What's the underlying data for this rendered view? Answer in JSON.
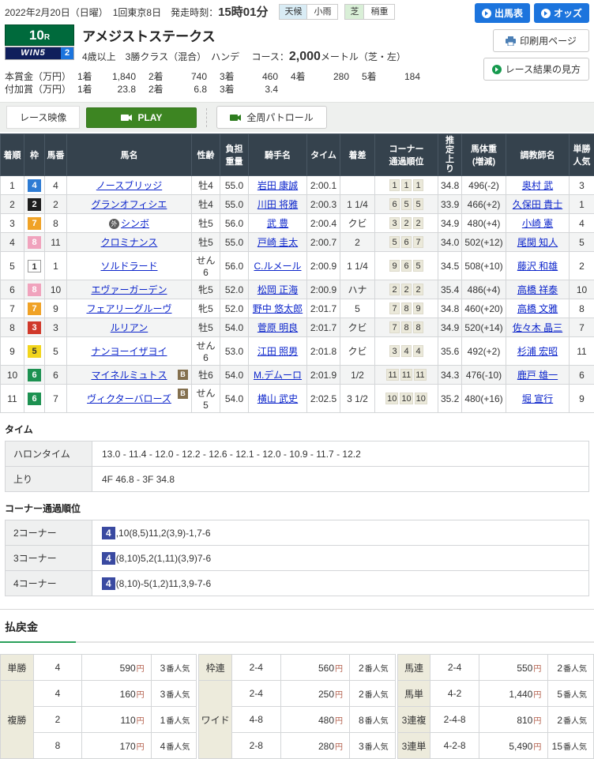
{
  "colors": {
    "accent_blue": "#1c74dd",
    "accent_green": "#3d8522",
    "race_badge_green": "#006a3c",
    "header_slate": "#35424d",
    "payout_underline_green": "#2aa05a",
    "corner_leader_indigo": "#3a4aa1",
    "waku": {
      "1": "#ffffff",
      "2": "#1d1d1d",
      "3": "#d0392b",
      "4": "#2d7bd3",
      "5": "#f2d51c",
      "6": "#1d9151",
      "7": "#f0a226",
      "8": "#f0a3bd"
    }
  },
  "header": {
    "date_line": "2022年2月20日（日曜）　1回東京8日　",
    "start_label": "発走時刻：",
    "start_time": "15時01分",
    "weather_label": "天候",
    "weather_value": "小雨",
    "turf_label": "芝",
    "turf_value": "稍重",
    "btn_entries": "出馬表",
    "btn_odds": "オッズ",
    "btn_print": "印刷用ページ",
    "btn_guide": "レース結果の見方"
  },
  "race": {
    "number": "10",
    "number_suffix": "R",
    "win5_text": "WIN5",
    "win5_num": "2",
    "name": "アメジストステークス",
    "conditions": "4歳以上　3勝クラス（混合）　ハンデ",
    "course_label": "コース：",
    "course_distance": "2,000",
    "course_unit": "メートル（芝・左）"
  },
  "prize": {
    "main_label": "本賞金（万円）",
    "main": [
      [
        "1着",
        "1,840"
      ],
      [
        "2着",
        "740"
      ],
      [
        "3着",
        "460"
      ],
      [
        "4着",
        "280"
      ],
      [
        "5着",
        "184"
      ]
    ],
    "added_label": "付加賞（万円）",
    "added": [
      [
        "1着",
        "23.8"
      ],
      [
        "2着",
        "6.8"
      ],
      [
        "3着",
        "3.4"
      ]
    ]
  },
  "video": {
    "label": "レース映像",
    "play": "PLAY",
    "patrol": "全周パトロール"
  },
  "results": {
    "headers": [
      "着順",
      "枠",
      "馬番",
      "馬名",
      "性齢",
      "負担\n重量",
      "騎手名",
      "タイム",
      "着差",
      "コーナー\n通過順位",
      "推定上り",
      "馬体重\n(増減)",
      "調教師名",
      "単勝\n人気"
    ],
    "rows": [
      {
        "pos": "1",
        "waku": "4",
        "num": "4",
        "mark": "",
        "horse": "ノースブリッジ",
        "blinker": false,
        "sex_age": "牡4",
        "weight": "55.0",
        "jockey": "岩田 康誠",
        "time": "2:00.1",
        "margin": "",
        "corners": [
          "1",
          "1",
          "1"
        ],
        "last3f": "34.8",
        "body": "496(-2)",
        "trainer": "奥村 武",
        "pop": "3"
      },
      {
        "pos": "2",
        "waku": "2",
        "num": "2",
        "mark": "",
        "horse": "グランオフィシエ",
        "blinker": false,
        "sex_age": "牡4",
        "weight": "55.0",
        "jockey": "川田 将雅",
        "time": "2:00.3",
        "margin": "1 1/4",
        "corners": [
          "6",
          "5",
          "5"
        ],
        "last3f": "33.9",
        "body": "466(+2)",
        "trainer": "久保田 貴士",
        "pop": "1"
      },
      {
        "pos": "3",
        "waku": "7",
        "num": "8",
        "mark": "外",
        "horse": "シンボ",
        "blinker": false,
        "sex_age": "牡5",
        "weight": "56.0",
        "jockey": "武 豊",
        "time": "2:00.4",
        "margin": "クビ",
        "corners": [
          "3",
          "2",
          "2"
        ],
        "last3f": "34.9",
        "body": "480(+4)",
        "trainer": "小崎 憲",
        "pop": "4"
      },
      {
        "pos": "4",
        "waku": "8",
        "num": "11",
        "mark": "",
        "horse": "クロミナンス",
        "blinker": false,
        "sex_age": "牡5",
        "weight": "55.0",
        "jockey": "戸崎 圭太",
        "time": "2:00.7",
        "margin": "2",
        "corners": [
          "5",
          "6",
          "7"
        ],
        "last3f": "34.0",
        "body": "502(+12)",
        "trainer": "尾関 知人",
        "pop": "5"
      },
      {
        "pos": "5",
        "waku": "1",
        "num": "1",
        "mark": "",
        "horse": "ソルドラード",
        "blinker": false,
        "sex_age": "せん6",
        "weight": "56.0",
        "jockey": "C.ルメール",
        "time": "2:00.9",
        "margin": "1 1/4",
        "corners": [
          "9",
          "6",
          "5"
        ],
        "last3f": "34.5",
        "body": "508(+10)",
        "trainer": "藤沢 和雄",
        "pop": "2"
      },
      {
        "pos": "6",
        "waku": "8",
        "num": "10",
        "mark": "",
        "horse": "エヴァーガーデン",
        "blinker": false,
        "sex_age": "牝5",
        "weight": "52.0",
        "jockey": "松岡 正海",
        "time": "2:00.9",
        "margin": "ハナ",
        "corners": [
          "2",
          "2",
          "2"
        ],
        "last3f": "35.4",
        "body": "486(+4)",
        "trainer": "高橋 祥泰",
        "pop": "10"
      },
      {
        "pos": "7",
        "waku": "7",
        "num": "9",
        "mark": "",
        "horse": "フェアリーグルーヴ",
        "blinker": false,
        "sex_age": "牝5",
        "weight": "52.0",
        "jockey": "野中 悠太郎",
        "time": "2:01.7",
        "margin": "5",
        "corners": [
          "7",
          "8",
          "9"
        ],
        "last3f": "34.8",
        "body": "460(+20)",
        "trainer": "高橋 文雅",
        "pop": "8"
      },
      {
        "pos": "8",
        "waku": "3",
        "num": "3",
        "mark": "",
        "horse": "ルリアン",
        "blinker": false,
        "sex_age": "牡5",
        "weight": "54.0",
        "jockey": "菅原 明良",
        "time": "2:01.7",
        "margin": "クビ",
        "corners": [
          "7",
          "8",
          "8"
        ],
        "last3f": "34.9",
        "body": "520(+14)",
        "trainer": "佐々木 晶三",
        "pop": "7"
      },
      {
        "pos": "9",
        "waku": "5",
        "num": "5",
        "mark": "",
        "horse": "ナンヨーイザヨイ",
        "blinker": false,
        "sex_age": "せん6",
        "weight": "53.0",
        "jockey": "江田 照男",
        "time": "2:01.8",
        "margin": "クビ",
        "corners": [
          "3",
          "4",
          "4"
        ],
        "last3f": "35.6",
        "body": "492(+2)",
        "trainer": "杉浦 宏昭",
        "pop": "11"
      },
      {
        "pos": "10",
        "waku": "6",
        "num": "6",
        "mark": "",
        "horse": "マイネルミュトス",
        "blinker": true,
        "sex_age": "牡6",
        "weight": "54.0",
        "jockey": "M.デムーロ",
        "time": "2:01.9",
        "margin": "1/2",
        "corners": [
          "11",
          "11",
          "11"
        ],
        "last3f": "34.3",
        "body": "476(-10)",
        "trainer": "鹿戸 雄一",
        "pop": "6"
      },
      {
        "pos": "11",
        "waku": "6",
        "num": "7",
        "mark": "",
        "horse": "ヴィクターバローズ",
        "blinker": true,
        "sex_age": "せん5",
        "weight": "54.0",
        "jockey": "横山 武史",
        "time": "2:02.5",
        "margin": "3 1/2",
        "corners": [
          "10",
          "10",
          "10"
        ],
        "last3f": "35.2",
        "body": "480(+16)",
        "trainer": "堀 宣行",
        "pop": "9"
      }
    ]
  },
  "time_section": {
    "title": "タイム",
    "rows": [
      [
        "ハロンタイム",
        "13.0 - 11.4 - 12.0 - 12.2 - 12.6 - 12.1 - 12.0 - 10.9 - 11.7 - 12.2"
      ],
      [
        "上り",
        "4F 46.8 - 3F 34.8"
      ]
    ]
  },
  "corner_section": {
    "title": "コーナー通過順位",
    "rows": [
      {
        "label": "2コーナー",
        "leader": "4",
        "rest": ",10(8,5)11,2(3,9)-1,7-6"
      },
      {
        "label": "3コーナー",
        "leader": "4",
        "rest": "(8,10)5,2(1,11)(3,9)7-6"
      },
      {
        "label": "4コーナー",
        "leader": "4",
        "rest": "(8,10)-5(1,2)11,3,9-7-6"
      }
    ]
  },
  "payout": {
    "title": "払戻金",
    "yen": "円",
    "pop_suffix": "番人気",
    "groups": [
      {
        "cells": [
          {
            "label": "単勝",
            "rows": [
              {
                "num": "4",
                "amount": "590",
                "pop": "3"
              }
            ]
          },
          {
            "label": "複勝",
            "rows": [
              {
                "num": "4",
                "amount": "160",
                "pop": "3"
              },
              {
                "num": "2",
                "amount": "110",
                "pop": "1"
              },
              {
                "num": "8",
                "amount": "170",
                "pop": "4"
              }
            ]
          }
        ]
      },
      {
        "cells": [
          {
            "label": "枠連",
            "rows": [
              {
                "num": "2-4",
                "amount": "560",
                "pop": "2"
              }
            ]
          },
          {
            "label": "ワイド",
            "rows": [
              {
                "num": "2-4",
                "amount": "250",
                "pop": "2"
              },
              {
                "num": "4-8",
                "amount": "480",
                "pop": "8"
              },
              {
                "num": "2-8",
                "amount": "280",
                "pop": "3"
              }
            ]
          }
        ]
      },
      {
        "cells": [
          {
            "label": "馬連",
            "rows": [
              {
                "num": "2-4",
                "amount": "550",
                "pop": "2"
              }
            ]
          },
          {
            "label": "馬単",
            "rows": [
              {
                "num": "4-2",
                "amount": "1,440",
                "pop": "5"
              }
            ]
          },
          {
            "label": "3連複",
            "rows": [
              {
                "num": "2-4-8",
                "amount": "810",
                "pop": "2"
              }
            ]
          },
          {
            "label": "3連単",
            "rows": [
              {
                "num": "4-2-8",
                "amount": "5,490",
                "pop": "15"
              }
            ]
          }
        ]
      }
    ]
  }
}
